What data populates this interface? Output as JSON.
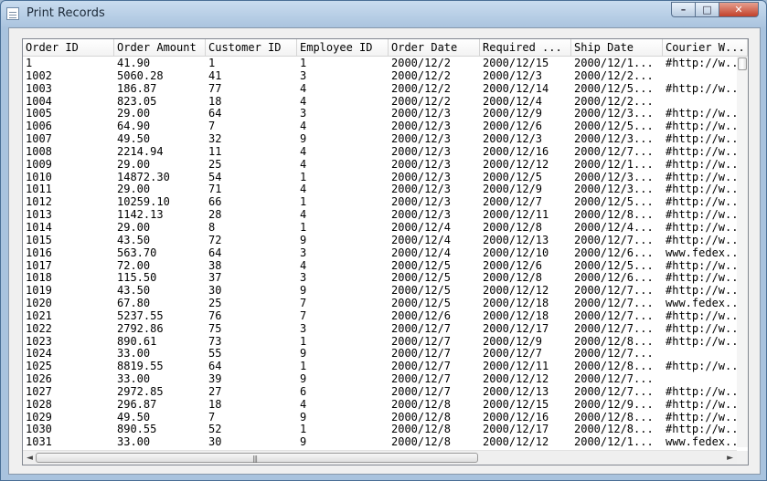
{
  "window": {
    "title": "Print Records",
    "min": "–",
    "max": "□",
    "close": "✕"
  },
  "columns": [
    "Order ID",
    "Order Amount",
    "Customer ID",
    "Employee ID",
    "Order Date",
    "Required ...",
    "Ship Date",
    "Courier W..."
  ],
  "rows": [
    [
      "1",
      "41.90",
      "1",
      "1",
      "2000/12/2",
      "2000/12/15",
      "2000/12/1...",
      "#http://w..."
    ],
    [
      "1002",
      "5060.28",
      "41",
      "3",
      "2000/12/2",
      "2000/12/3",
      "2000/12/2...",
      ""
    ],
    [
      "1003",
      "186.87",
      "77",
      "4",
      "2000/12/2",
      "2000/12/14",
      "2000/12/5...",
      "#http://w..."
    ],
    [
      "1004",
      "823.05",
      "18",
      "4",
      "2000/12/2",
      "2000/12/4",
      "2000/12/2...",
      ""
    ],
    [
      "1005",
      "29.00",
      "64",
      "3",
      "2000/12/3",
      "2000/12/9",
      "2000/12/3...",
      "#http://w..."
    ],
    [
      "1006",
      "64.90",
      "7",
      "4",
      "2000/12/3",
      "2000/12/6",
      "2000/12/5...",
      "#http://w..."
    ],
    [
      "1007",
      "49.50",
      "32",
      "9",
      "2000/12/3",
      "2000/12/3",
      "2000/12/3...",
      "#http://w..."
    ],
    [
      "1008",
      "2214.94",
      "11",
      "4",
      "2000/12/3",
      "2000/12/16",
      "2000/12/7...",
      "#http://w..."
    ],
    [
      "1009",
      "29.00",
      "25",
      "4",
      "2000/12/3",
      "2000/12/12",
      "2000/12/1...",
      "#http://w..."
    ],
    [
      "1010",
      "14872.30",
      "54",
      "1",
      "2000/12/3",
      "2000/12/5",
      "2000/12/3...",
      "#http://w..."
    ],
    [
      "1011",
      "29.00",
      "71",
      "4",
      "2000/12/3",
      "2000/12/9",
      "2000/12/3...",
      "#http://w..."
    ],
    [
      "1012",
      "10259.10",
      "66",
      "1",
      "2000/12/3",
      "2000/12/7",
      "2000/12/5...",
      "#http://w..."
    ],
    [
      "1013",
      "1142.13",
      "28",
      "4",
      "2000/12/3",
      "2000/12/11",
      "2000/12/8...",
      "#http://w..."
    ],
    [
      "1014",
      "29.00",
      "8",
      "1",
      "2000/12/4",
      "2000/12/8",
      "2000/12/4...",
      "#http://w..."
    ],
    [
      "1015",
      "43.50",
      "72",
      "9",
      "2000/12/4",
      "2000/12/13",
      "2000/12/7...",
      "#http://w..."
    ],
    [
      "1016",
      "563.70",
      "64",
      "3",
      "2000/12/4",
      "2000/12/10",
      "2000/12/6...",
      "www.fedex..."
    ],
    [
      "1017",
      "72.00",
      "38",
      "4",
      "2000/12/5",
      "2000/12/6",
      "2000/12/5...",
      "#http://w..."
    ],
    [
      "1018",
      "115.50",
      "37",
      "3",
      "2000/12/5",
      "2000/12/8",
      "2000/12/6...",
      "#http://w..."
    ],
    [
      "1019",
      "43.50",
      "30",
      "9",
      "2000/12/5",
      "2000/12/12",
      "2000/12/7...",
      "#http://w..."
    ],
    [
      "1020",
      "67.80",
      "25",
      "7",
      "2000/12/5",
      "2000/12/18",
      "2000/12/7...",
      "www.fedex..."
    ],
    [
      "1021",
      "5237.55",
      "76",
      "7",
      "2000/12/6",
      "2000/12/18",
      "2000/12/7...",
      "#http://w..."
    ],
    [
      "1022",
      "2792.86",
      "75",
      "3",
      "2000/12/7",
      "2000/12/17",
      "2000/12/7...",
      "#http://w..."
    ],
    [
      "1023",
      "890.61",
      "73",
      "1",
      "2000/12/7",
      "2000/12/9",
      "2000/12/8...",
      "#http://w..."
    ],
    [
      "1024",
      "33.00",
      "55",
      "9",
      "2000/12/7",
      "2000/12/7",
      "2000/12/7...",
      ""
    ],
    [
      "1025",
      "8819.55",
      "64",
      "1",
      "2000/12/7",
      "2000/12/11",
      "2000/12/8...",
      "#http://w..."
    ],
    [
      "1026",
      "33.00",
      "39",
      "9",
      "2000/12/7",
      "2000/12/12",
      "2000/12/7...",
      ""
    ],
    [
      "1027",
      "2972.85",
      "27",
      "6",
      "2000/12/7",
      "2000/12/13",
      "2000/12/7...",
      "#http://w..."
    ],
    [
      "1028",
      "296.87",
      "18",
      "4",
      "2000/12/8",
      "2000/12/15",
      "2000/12/9...",
      "#http://w..."
    ],
    [
      "1029",
      "49.50",
      "7",
      "9",
      "2000/12/8",
      "2000/12/16",
      "2000/12/8...",
      "#http://w..."
    ],
    [
      "1030",
      "890.55",
      "52",
      "1",
      "2000/12/8",
      "2000/12/17",
      "2000/12/8...",
      "#http://w..."
    ],
    [
      "1031",
      "33.00",
      "30",
      "9",
      "2000/12/8",
      "2000/12/12",
      "2000/12/1...",
      "www.fedex..."
    ]
  ],
  "scroll": {
    "left_arrow": "◄",
    "right_arrow": "►",
    "grip": "|||"
  }
}
